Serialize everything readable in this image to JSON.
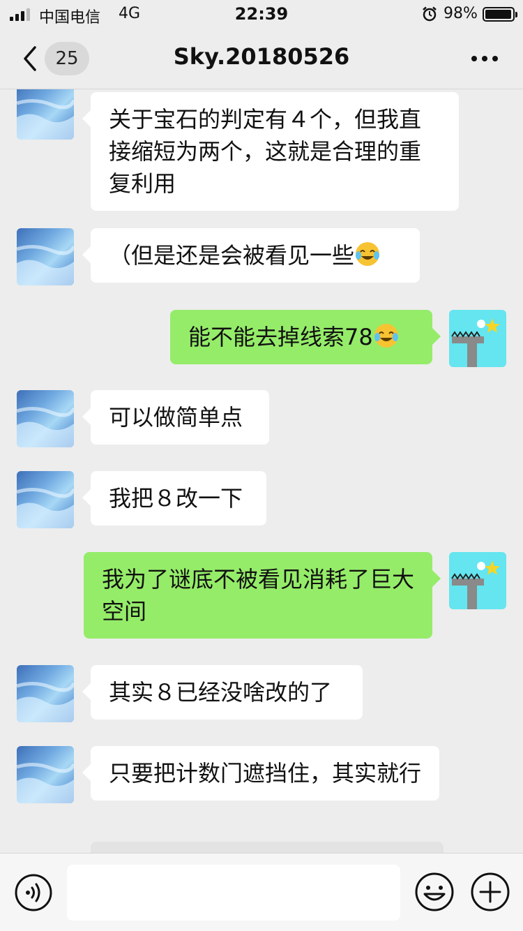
{
  "status_bar": {
    "carrier": "中国电信",
    "network": "4G",
    "time": "22:39",
    "battery_percent": "98%",
    "battery_level": 0.98
  },
  "nav": {
    "unread_count": "25",
    "title": "Sky.20180526"
  },
  "messages": [
    {
      "side": "in",
      "text": "关于宝石的判定有４个，但我直接缩短为两个，这就是合理的重复利用"
    },
    {
      "side": "in",
      "text": "（但是还是会被看见一些",
      "emoji": "laughing-crying-emoji"
    },
    {
      "side": "out",
      "text": "能不能去掉线索78",
      "emoji": "laughing-crying-emoji"
    },
    {
      "side": "in",
      "text": "可以做简单点"
    },
    {
      "side": "in",
      "text": "我把８改一下"
    },
    {
      "side": "out",
      "text": "我为了谜底不被看见消耗了巨大空间"
    },
    {
      "side": "in",
      "text": "其实８已经没啥改的了"
    },
    {
      "side": "in",
      "text": "只要把计数门遮挡住，其实就行"
    }
  ],
  "input": {
    "value": "",
    "placeholder": ""
  },
  "colors": {
    "background": "#ededed",
    "incoming_bubble": "#ffffff",
    "outgoing_bubble": "#95ec69",
    "my_avatar_bg": "#64e5ef"
  },
  "icons": {
    "back": "chevron-left-icon",
    "more": "more-dots-icon",
    "voice": "voice-icon",
    "emoji": "smiley-icon",
    "plus": "plus-icon",
    "alarm": "alarm-icon"
  }
}
